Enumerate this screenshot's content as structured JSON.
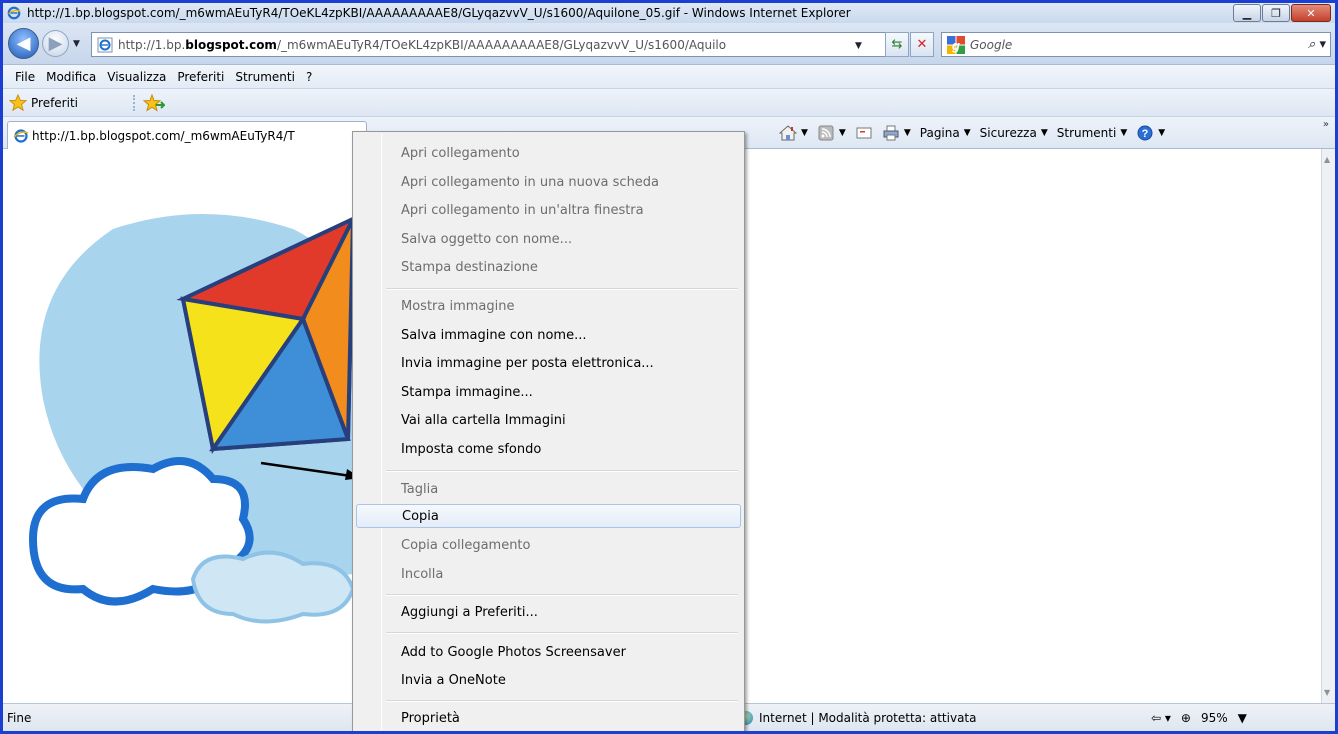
{
  "window": {
    "title": "http://1.bp.blogspot.com/_m6wmAEuTyR4/TOeKL4zpKBI/AAAAAAAAAE8/GLyqazvvV_U/s1600/Aquilone_05.gif - Windows Internet Explorer"
  },
  "address": {
    "url_prefix": "http://1.bp.",
    "url_domain": "blogspot.com",
    "url_rest": "/_m6wmAEuTyR4/TOeKL4zpKBI/AAAAAAAAAE8/GLyqazvvV_U/s1600/Aquilo"
  },
  "search": {
    "placeholder": "Google"
  },
  "menubar": [
    "File",
    "Modifica",
    "Visualizza",
    "Preferiti",
    "Strumenti",
    "?"
  ],
  "favorites": {
    "label": "Preferiti"
  },
  "tab": {
    "title": "http://1.bp.blogspot.com/_m6wmAEuTyR4/T"
  },
  "commandbar": {
    "page": "Pagina",
    "security": "Sicurezza",
    "tools": "Strumenti"
  },
  "status": {
    "left": "Fine",
    "zone": "Internet | Modalità protetta: attivata",
    "zoom": "95%"
  },
  "context_menu": {
    "items": [
      {
        "label": "Apri collegamento",
        "enabled": false
      },
      {
        "label": "Apri collegamento in una nuova scheda",
        "enabled": false
      },
      {
        "label": "Apri collegamento in un'altra finestra",
        "enabled": false
      },
      {
        "label": "Salva oggetto con nome...",
        "enabled": false
      },
      {
        "label": "Stampa destinazione",
        "enabled": false
      },
      {
        "label": "Mostra immagine",
        "enabled": false
      },
      {
        "label": "Salva immagine con nome...",
        "enabled": true
      },
      {
        "label": "Invia immagine per posta elettronica...",
        "enabled": true
      },
      {
        "label": "Stampa immagine...",
        "enabled": true
      },
      {
        "label": "Vai alla cartella Immagini",
        "enabled": true
      },
      {
        "label": "Imposta come sfondo",
        "enabled": true
      },
      {
        "label": "Taglia",
        "enabled": false
      },
      {
        "label": "Copia",
        "enabled": true,
        "highlighted": true
      },
      {
        "label": "Copia collegamento",
        "enabled": false
      },
      {
        "label": "Incolla",
        "enabled": false
      },
      {
        "label": "Aggiungi a Preferiti...",
        "enabled": true
      },
      {
        "label": "Add to Google Photos Screensaver",
        "enabled": true
      },
      {
        "label": "Invia a OneNote",
        "enabled": true
      },
      {
        "label": "Proprietà",
        "enabled": true
      }
    ]
  },
  "colors": {
    "border_frame": "#1a3fd1",
    "menu_highlight": "#a8c4e6",
    "disabled_text": "#6d6d6d"
  }
}
